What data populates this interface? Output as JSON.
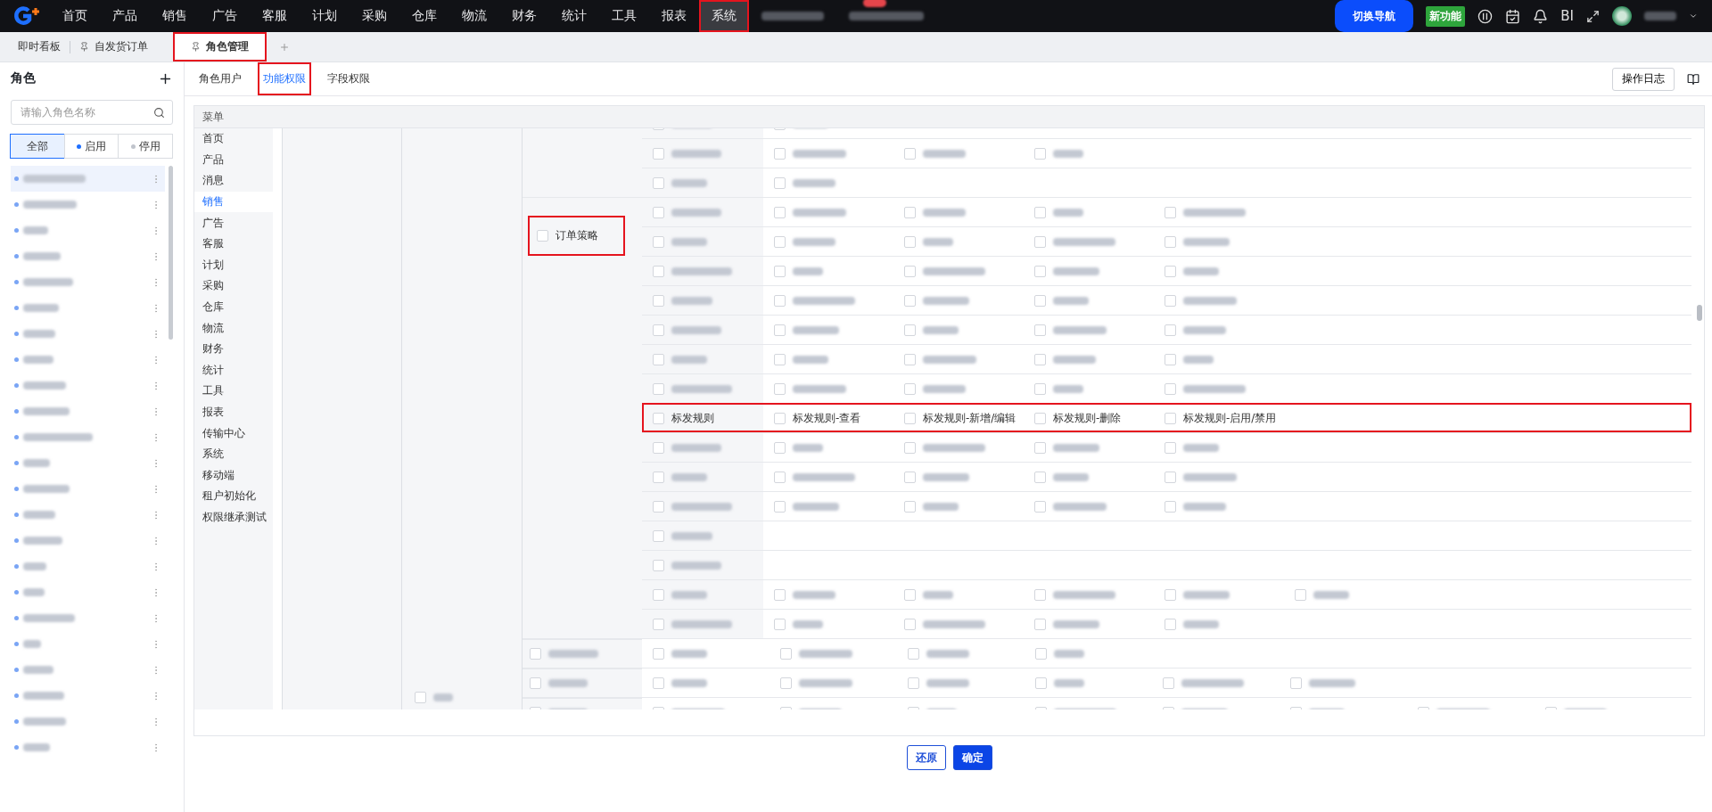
{
  "top_nav": {
    "items": [
      {
        "kind": "text",
        "label": "首页",
        "selected": false,
        "highlighted": false
      },
      {
        "kind": "text",
        "label": "产品",
        "selected": false,
        "highlighted": false
      },
      {
        "kind": "text",
        "label": "销售",
        "selected": false,
        "highlighted": false
      },
      {
        "kind": "text",
        "label": "广告",
        "selected": false,
        "highlighted": false
      },
      {
        "kind": "text",
        "label": "客服",
        "selected": false,
        "highlighted": false
      },
      {
        "kind": "text",
        "label": "计划",
        "selected": false,
        "highlighted": false
      },
      {
        "kind": "text",
        "label": "采购",
        "selected": false,
        "highlighted": false
      },
      {
        "kind": "text",
        "label": "仓库",
        "selected": false,
        "highlighted": false
      },
      {
        "kind": "text",
        "label": "物流",
        "selected": false,
        "highlighted": false
      },
      {
        "kind": "text",
        "label": "财务",
        "selected": false,
        "highlighted": false
      },
      {
        "kind": "text",
        "label": "统计",
        "selected": false,
        "highlighted": false
      },
      {
        "kind": "text",
        "label": "工具",
        "selected": false,
        "highlighted": false
      },
      {
        "kind": "text",
        "label": "报表",
        "selected": false,
        "highlighted": false
      },
      {
        "kind": "text",
        "label": "系统",
        "selected": true,
        "highlighted": true
      },
      {
        "kind": "redacted",
        "selected": false,
        "highlighted": false
      },
      {
        "kind": "redacted-badge",
        "selected": false,
        "highlighted": false
      }
    ],
    "switch_button": "切换导航",
    "new_feature_badge": "新功能",
    "bi_label": "BI"
  },
  "page_tabs": [
    {
      "kind": "plain",
      "label": "即时看板",
      "selected": false,
      "highlighted": false
    },
    {
      "kind": "pinned",
      "label": "自发货订单",
      "selected": false,
      "highlighted": false
    },
    {
      "kind": "pinned",
      "label": "角色管理",
      "selected": true,
      "highlighted": true
    }
  ],
  "sidebar": {
    "title": "角色",
    "search": {
      "placeholder": "请输入角色名称"
    },
    "filters": [
      {
        "kind": "plain",
        "label": "全部",
        "selected": true
      },
      {
        "kind": "dot",
        "label": "启用",
        "selected": false,
        "color": "#1e6fff"
      },
      {
        "kind": "dot",
        "label": "停用",
        "selected": false,
        "color": "#c0c4cc"
      }
    ],
    "roles": [
      {
        "selected": true
      },
      {
        "selected": false
      },
      {
        "selected": false
      },
      {
        "selected": false
      },
      {
        "selected": false
      },
      {
        "selected": false
      },
      {
        "selected": false
      },
      {
        "selected": false
      },
      {
        "selected": false
      },
      {
        "selected": false
      },
      {
        "selected": false
      },
      {
        "selected": false
      },
      {
        "selected": false
      },
      {
        "selected": false
      },
      {
        "selected": false
      },
      {
        "selected": false
      },
      {
        "selected": false
      },
      {
        "selected": false
      },
      {
        "selected": false
      },
      {
        "selected": false
      },
      {
        "selected": false
      },
      {
        "selected": false
      },
      {
        "selected": false
      }
    ]
  },
  "sub_tabs": [
    {
      "label": "角色用户",
      "selected": false,
      "highlighted": false
    },
    {
      "label": "功能权限",
      "selected": true,
      "highlighted": true
    },
    {
      "label": "字段权限",
      "selected": false,
      "highlighted": false
    }
  ],
  "log_button": "操作日志",
  "menu": {
    "header": "菜单",
    "items": [
      {
        "label": "首页",
        "selected": false
      },
      {
        "label": "产品",
        "selected": false
      },
      {
        "label": "消息",
        "selected": false
      },
      {
        "label": "销售",
        "selected": true
      },
      {
        "label": "广告",
        "selected": false
      },
      {
        "label": "客服",
        "selected": false
      },
      {
        "label": "计划",
        "selected": false
      },
      {
        "label": "采购",
        "selected": false
      },
      {
        "label": "仓库",
        "selected": false
      },
      {
        "label": "物流",
        "selected": false
      },
      {
        "label": "财务",
        "selected": false
      },
      {
        "label": "统计",
        "selected": false
      },
      {
        "label": "工具",
        "selected": false
      },
      {
        "label": "报表",
        "selected": false
      },
      {
        "label": "传输中心",
        "selected": false
      },
      {
        "label": "系统",
        "selected": false
      },
      {
        "label": "移动端",
        "selected": false
      },
      {
        "label": "租户初始化",
        "selected": false
      },
      {
        "label": "权限继承测试",
        "selected": false
      }
    ]
  },
  "permission_groups": [
    {
      "kind": "blank",
      "rows": [
        {
          "kind": "redacted",
          "checked": false,
          "highlighted": false,
          "perms": [
            {
              "kind": "redacted",
              "checked": false
            }
          ]
        },
        {
          "kind": "redacted",
          "checked": false,
          "highlighted": false,
          "perms": [
            {
              "kind": "redacted",
              "checked": false
            },
            {
              "kind": "redacted",
              "checked": false
            },
            {
              "kind": "redacted",
              "checked": false
            }
          ]
        },
        {
          "kind": "redacted",
          "checked": false,
          "highlighted": false,
          "perms": [
            {
              "kind": "redacted",
              "checked": false
            }
          ]
        }
      ]
    },
    {
      "kind": "text",
      "label": "订单策略",
      "checked": false,
      "highlighted": true,
      "rows": [
        {
          "kind": "redacted",
          "checked": false,
          "highlighted": false,
          "perms": [
            {
              "kind": "redacted",
              "checked": false
            },
            {
              "kind": "redacted",
              "checked": false
            },
            {
              "kind": "redacted",
              "checked": false
            },
            {
              "kind": "redacted",
              "checked": false
            }
          ]
        },
        {
          "kind": "redacted",
          "checked": false,
          "highlighted": false,
          "perms": [
            {
              "kind": "redacted",
              "checked": false
            },
            {
              "kind": "redacted",
              "checked": false
            },
            {
              "kind": "redacted",
              "checked": false
            },
            {
              "kind": "redacted",
              "checked": false
            }
          ]
        },
        {
          "kind": "redacted",
          "checked": false,
          "highlighted": false,
          "perms": [
            {
              "kind": "redacted",
              "checked": false
            },
            {
              "kind": "redacted",
              "checked": false
            },
            {
              "kind": "redacted",
              "checked": false
            },
            {
              "kind": "redacted",
              "checked": false
            }
          ]
        },
        {
          "kind": "redacted",
          "checked": false,
          "highlighted": false,
          "perms": [
            {
              "kind": "redacted",
              "checked": false
            },
            {
              "kind": "redacted",
              "checked": false
            },
            {
              "kind": "redacted",
              "checked": false
            },
            {
              "kind": "redacted",
              "checked": false
            }
          ]
        },
        {
          "kind": "redacted",
          "checked": false,
          "highlighted": false,
          "perms": [
            {
              "kind": "redacted",
              "checked": false
            },
            {
              "kind": "redacted",
              "checked": false
            },
            {
              "kind": "redacted",
              "checked": false
            },
            {
              "kind": "redacted",
              "checked": false
            }
          ]
        },
        {
          "kind": "redacted",
          "checked": false,
          "highlighted": false,
          "perms": [
            {
              "kind": "redacted",
              "checked": false
            },
            {
              "kind": "redacted",
              "checked": false
            },
            {
              "kind": "redacted",
              "checked": false
            },
            {
              "kind": "redacted",
              "checked": false
            }
          ]
        },
        {
          "kind": "redacted",
          "checked": false,
          "highlighted": false,
          "perms": [
            {
              "kind": "redacted",
              "checked": false
            },
            {
              "kind": "redacted",
              "checked": false
            },
            {
              "kind": "redacted",
              "checked": false
            },
            {
              "kind": "redacted",
              "checked": false
            }
          ]
        },
        {
          "kind": "text",
          "name": "标发规则",
          "checked": false,
          "highlighted": true,
          "perms": [
            {
              "kind": "text",
              "label": "标发规则-查看",
              "checked": false
            },
            {
              "kind": "text",
              "label": "标发规则-新增/编辑",
              "checked": false
            },
            {
              "kind": "text",
              "label": "标发规则-删除",
              "checked": false
            },
            {
              "kind": "text",
              "label": "标发规则-启用/禁用",
              "checked": false
            }
          ]
        },
        {
          "kind": "redacted",
          "checked": false,
          "highlighted": false,
          "perms": [
            {
              "kind": "redacted",
              "checked": false
            },
            {
              "kind": "redacted",
              "checked": false
            },
            {
              "kind": "redacted",
              "checked": false
            },
            {
              "kind": "redacted",
              "checked": false
            }
          ]
        },
        {
          "kind": "redacted",
          "checked": false,
          "highlighted": false,
          "perms": [
            {
              "kind": "redacted",
              "checked": false
            },
            {
              "kind": "redacted",
              "checked": false
            },
            {
              "kind": "redacted",
              "checked": false
            },
            {
              "kind": "redacted",
              "checked": false
            }
          ]
        },
        {
          "kind": "redacted",
          "checked": false,
          "highlighted": false,
          "perms": [
            {
              "kind": "redacted",
              "checked": false
            },
            {
              "kind": "redacted",
              "checked": false
            },
            {
              "kind": "redacted",
              "checked": false
            },
            {
              "kind": "redacted",
              "checked": false
            }
          ]
        },
        {
          "kind": "redacted",
          "checked": false,
          "highlighted": false,
          "perms": []
        },
        {
          "kind": "redacted",
          "checked": false,
          "highlighted": false,
          "perms": []
        },
        {
          "kind": "redacted",
          "checked": false,
          "highlighted": false,
          "perms": [
            {
              "kind": "redacted",
              "checked": false
            },
            {
              "kind": "redacted",
              "checked": false
            },
            {
              "kind": "redacted",
              "checked": false
            },
            {
              "kind": "redacted",
              "checked": false
            },
            {
              "kind": "redacted",
              "checked": false
            }
          ]
        },
        {
          "kind": "redacted",
          "checked": false,
          "highlighted": false,
          "perms": [
            {
              "kind": "redacted",
              "checked": false
            },
            {
              "kind": "redacted",
              "checked": false
            },
            {
              "kind": "redacted",
              "checked": false
            },
            {
              "kind": "redacted",
              "checked": false
            }
          ]
        }
      ]
    }
  ],
  "lower_groups": [
    {
      "kind": "blank",
      "rows": [
        {
          "kind": "redacted",
          "checked": false,
          "perms": [
            {
              "kind": "redacted",
              "checked": false
            },
            {
              "kind": "redacted",
              "checked": false
            },
            {
              "kind": "redacted",
              "checked": false
            },
            {
              "kind": "redacted",
              "checked": false
            }
          ]
        }
      ]
    },
    {
      "kind": "redacted",
      "checked": false,
      "rows": [
        {
          "kind": "redacted",
          "checked": false,
          "perms": [
            {
              "kind": "redacted",
              "checked": false
            },
            {
              "kind": "redacted",
              "checked": false
            },
            {
              "kind": "redacted",
              "checked": false
            },
            {
              "kind": "redacted",
              "checked": false
            },
            {
              "kind": "redacted",
              "checked": false
            },
            {
              "kind": "redacted",
              "checked": false
            }
          ]
        },
        {
          "kind": "redacted",
          "checked": false,
          "perms": [
            {
              "kind": "redacted",
              "checked": false
            },
            {
              "kind": "redacted",
              "checked": false
            },
            {
              "kind": "redacted",
              "checked": false
            },
            {
              "kind": "redacted",
              "checked": false
            },
            {
              "kind": "redacted",
              "checked": false
            },
            {
              "kind": "redacted",
              "checked": false
            },
            {
              "kind": "redacted",
              "checked": false
            },
            {
              "kind": "redacted",
              "checked": false
            }
          ]
        }
      ]
    }
  ],
  "actions": [
    {
      "kind": "secondary",
      "label": "还原"
    },
    {
      "kind": "primary",
      "label": "确定"
    }
  ]
}
